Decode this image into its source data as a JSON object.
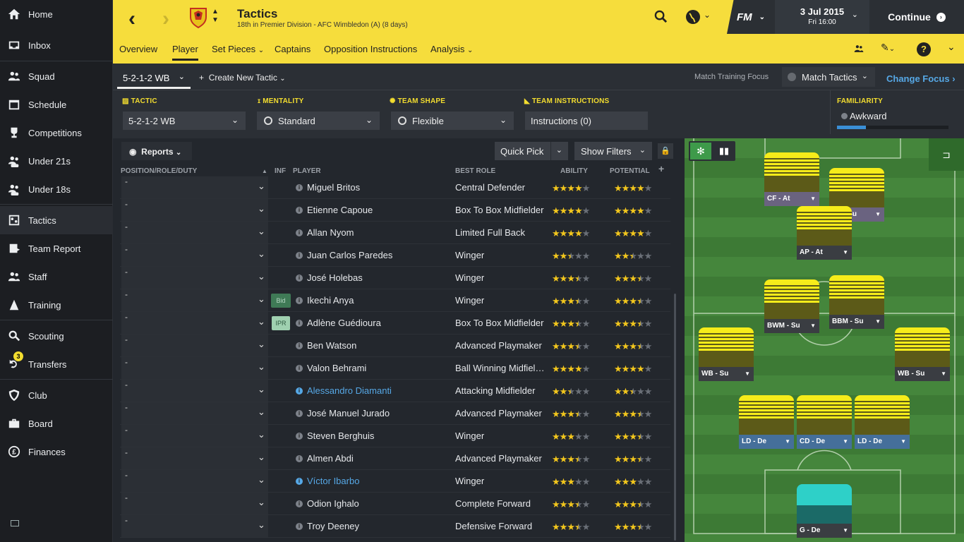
{
  "sidebar": {
    "items": [
      {
        "label": "Home",
        "icon": "home-icon"
      },
      {
        "label": "Inbox",
        "icon": "inbox-icon"
      },
      {
        "label": "Squad",
        "icon": "squad-icon"
      },
      {
        "label": "Schedule",
        "icon": "schedule-icon"
      },
      {
        "label": "Competitions",
        "icon": "trophy-icon"
      },
      {
        "label": "Under 21s",
        "icon": "under21-icon"
      },
      {
        "label": "Under 18s",
        "icon": "under18-icon"
      },
      {
        "label": "Tactics",
        "icon": "tactics-icon"
      },
      {
        "label": "Team Report",
        "icon": "report-icon"
      },
      {
        "label": "Staff",
        "icon": "staff-icon"
      },
      {
        "label": "Training",
        "icon": "training-icon"
      },
      {
        "label": "Scouting",
        "icon": "scouting-icon"
      },
      {
        "label": "Transfers",
        "icon": "transfers-icon",
        "badge": "3"
      },
      {
        "label": "Club",
        "icon": "club-icon"
      },
      {
        "label": "Board",
        "icon": "board-icon"
      },
      {
        "label": "Finances",
        "icon": "finances-icon"
      }
    ]
  },
  "header": {
    "title": "Tactics",
    "subtitle": "18th in Premier Division - AFC Wimbledon (A) (8 days)",
    "tabs": [
      "Overview",
      "Player",
      "Set Pieces",
      "Captains",
      "Opposition Instructions",
      "Analysis"
    ],
    "brand": "FM",
    "date": "3 Jul 2015",
    "time": "Fri 16:00",
    "continue_label": "Continue",
    "help_label": "?"
  },
  "toolbar": {
    "tactic_tab": "5-2-1-2 WB",
    "create_label": "Create New Tactic",
    "training_focus_label": "Match Training Focus",
    "match_tactics_label": "Match Tactics",
    "change_focus_label": "Change Focus"
  },
  "filters": {
    "tactic_label": "TACTIC",
    "tactic_value": "5-2-1-2 WB",
    "mentality_label": "MENTALITY",
    "mentality_value": "Standard",
    "shape_label": "TEAM SHAPE",
    "shape_value": "Flexible",
    "instructions_label": "TEAM INSTRUCTIONS",
    "instructions_value": "Instructions (0)",
    "familiarity_label": "FAMILIARITY",
    "familiarity_value": "Awkward",
    "familiarity_level": 0.26
  },
  "grid": {
    "reports_label": "Reports",
    "quick_pick_label": "Quick Pick",
    "show_filters_label": "Show Filters",
    "columns": [
      "POSITION/ROLE/DUTY",
      "INF",
      "PLAYER",
      "BEST ROLE",
      "ABILITY",
      "POTENTIAL"
    ],
    "add_column_label": "+",
    "rows": [
      {
        "pos": "-",
        "tag": "",
        "name": "Miguel Britos",
        "role": "Central Defender",
        "ability": 4,
        "potential": 4,
        "highlight": false
      },
      {
        "pos": "-",
        "tag": "",
        "name": "Etienne Capoue",
        "role": "Box To Box Midfielder",
        "ability": 4,
        "potential": 4,
        "highlight": false
      },
      {
        "pos": "-",
        "tag": "",
        "name": "Allan Nyom",
        "role": "Limited Full Back",
        "ability": 4,
        "potential": 4,
        "highlight": false
      },
      {
        "pos": "-",
        "tag": "",
        "name": "Juan Carlos Paredes",
        "role": "Winger",
        "ability": 2.5,
        "potential": 2.5,
        "highlight": false
      },
      {
        "pos": "-",
        "tag": "",
        "name": "José Holebas",
        "role": "Winger",
        "ability": 3.5,
        "potential": 3.5,
        "highlight": false
      },
      {
        "pos": "-",
        "tag": "Bid",
        "name": "Ikechi Anya",
        "role": "Winger",
        "ability": 3.5,
        "potential": 3.5,
        "highlight": false
      },
      {
        "pos": "-",
        "tag": "IPR",
        "name": "Adlène Guédioura",
        "role": "Box To Box Midfielder",
        "ability": 3.5,
        "potential": 3.5,
        "highlight": false
      },
      {
        "pos": "-",
        "tag": "",
        "name": "Ben Watson",
        "role": "Advanced Playmaker",
        "ability": 3.5,
        "potential": 3.5,
        "highlight": false
      },
      {
        "pos": "-",
        "tag": "",
        "name": "Valon Behrami",
        "role": "Ball Winning Midfielder",
        "ability": 4,
        "potential": 4,
        "highlight": false
      },
      {
        "pos": "-",
        "tag": "",
        "name": "Alessandro Diamanti",
        "role": "Attacking Midfielder",
        "ability": 2.5,
        "potential": 2.5,
        "highlight": true
      },
      {
        "pos": "-",
        "tag": "",
        "name": "José Manuel Jurado",
        "role": "Advanced Playmaker",
        "ability": 3.5,
        "potential": 3.5,
        "highlight": false
      },
      {
        "pos": "-",
        "tag": "",
        "name": "Steven Berghuis",
        "role": "Winger",
        "ability": 3,
        "potential": 3.5,
        "highlight": false
      },
      {
        "pos": "-",
        "tag": "",
        "name": "Almen Abdi",
        "role": "Advanced Playmaker",
        "ability": 3.5,
        "potential": 3.5,
        "highlight": false
      },
      {
        "pos": "-",
        "tag": "",
        "name": "Víctor Ibarbo",
        "role": "Winger",
        "ability": 3,
        "potential": 3,
        "highlight": true
      },
      {
        "pos": "-",
        "tag": "",
        "name": "Odion Ighalo",
        "role": "Complete Forward",
        "ability": 3.5,
        "potential": 3.5,
        "highlight": false
      },
      {
        "pos": "-",
        "tag": "",
        "name": "Troy Deeney",
        "role": "Defensive Forward",
        "ability": 3.5,
        "potential": 3.5,
        "highlight": false
      }
    ]
  },
  "pitch": {
    "positions": [
      {
        "label": "CF - At",
        "style": "purple"
      },
      {
        "label": "DF - Su",
        "style": "purple"
      },
      {
        "label": "AP - At",
        "style": "dark"
      },
      {
        "label": "BWM - Su",
        "style": "dark"
      },
      {
        "label": "BBM - Su",
        "style": "dark"
      },
      {
        "label": "WB - Su",
        "style": "dark"
      },
      {
        "label": "WB - Su",
        "style": "dark"
      },
      {
        "label": "LD - De",
        "style": "blue"
      },
      {
        "label": "CD - De",
        "style": "blue"
      },
      {
        "label": "LD - De",
        "style": "blue"
      },
      {
        "label": "G - De",
        "style": "dark"
      }
    ]
  },
  "colors": {
    "accent": "#f6dd3c",
    "link": "#56a8e6",
    "star": "#f3c71d",
    "keeper": "#2ed0c8"
  }
}
